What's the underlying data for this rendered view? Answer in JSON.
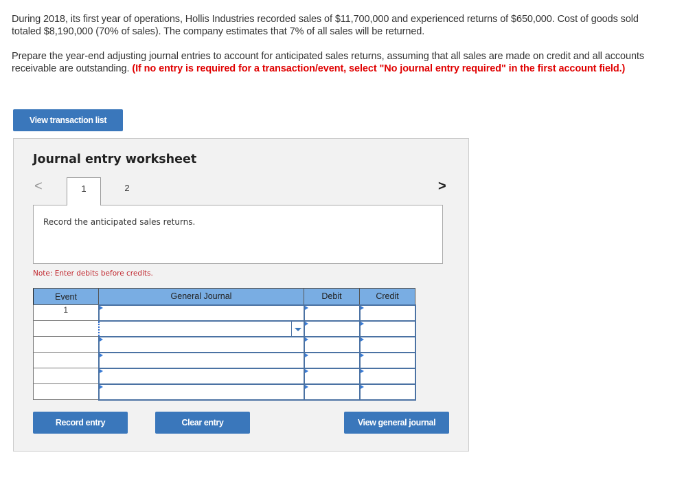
{
  "problem": {
    "paragraph1": "During 2018, its first year of operations, Hollis Industries recorded sales of $11,700,000 and experienced returns of $650,000. Cost of goods sold totaled $8,190,000 (70% of sales). The company estimates that 7% of all sales will be returned.",
    "paragraph2": "Prepare the year-end adjusting journal entries to account for anticipated sales returns, assuming that all sales are made on credit and all accounts receivable are outstanding.",
    "instruction": "(If no entry is required for a transaction/event, select \"No journal entry required\" in the first account field.)"
  },
  "buttons": {
    "view_transaction_list": "View transaction list",
    "record_entry": "Record entry",
    "clear_entry": "Clear entry",
    "view_general_journal": "View general journal"
  },
  "worksheet": {
    "title": "Journal entry worksheet",
    "nav_prev": "<",
    "nav_next": ">",
    "tabs": [
      {
        "label": "1",
        "active": true
      },
      {
        "label": "2",
        "active": false
      }
    ],
    "description": "Record the anticipated sales returns.",
    "note": "Note: Enter debits before credits.",
    "table": {
      "headers": [
        "Event",
        "General Journal",
        "Debit",
        "Credit"
      ],
      "rows": [
        {
          "event": "1",
          "account": "",
          "debit": "",
          "credit": ""
        },
        {
          "event": "",
          "account": "",
          "debit": "",
          "credit": "",
          "focused": true
        },
        {
          "event": "",
          "account": "",
          "debit": "",
          "credit": ""
        },
        {
          "event": "",
          "account": "",
          "debit": "",
          "credit": ""
        },
        {
          "event": "",
          "account": "",
          "debit": "",
          "credit": ""
        },
        {
          "event": "",
          "account": "",
          "debit": "",
          "credit": ""
        }
      ]
    }
  },
  "colors": {
    "button": "#3a77bb",
    "header": "#79ade3",
    "instruction_red": "#e00000",
    "note_red": "#c0262d"
  }
}
